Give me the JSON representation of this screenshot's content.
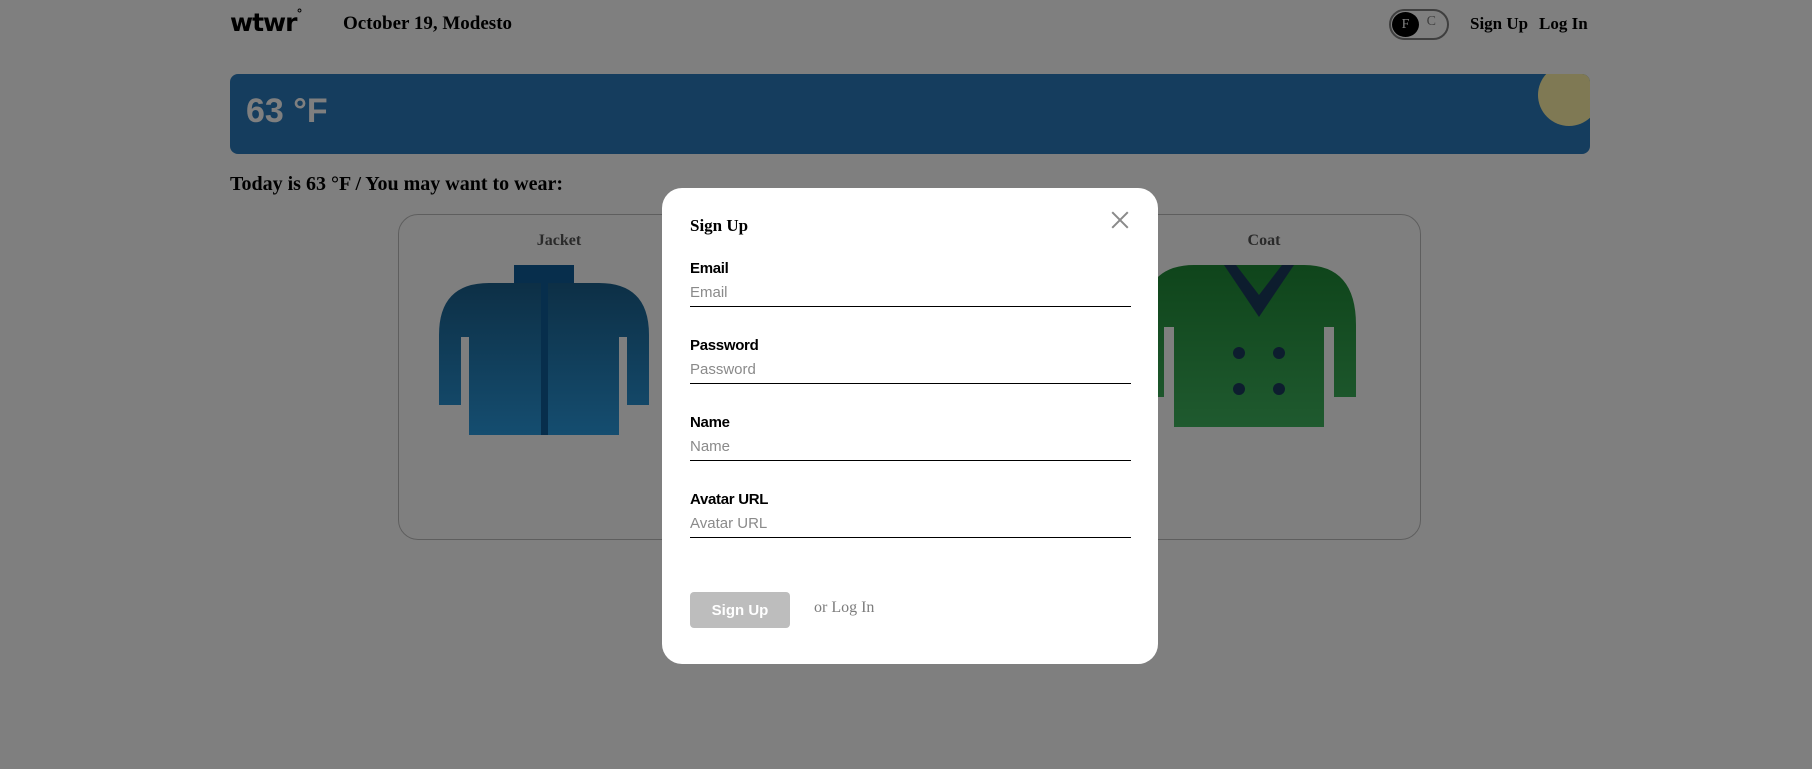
{
  "header": {
    "logo": "wtwr",
    "logo_mark": "°",
    "date_location": "October 19, Modesto",
    "unit_toggle": {
      "selected": "F",
      "other": "C"
    },
    "signup_label": "Sign Up",
    "login_label": "Log In"
  },
  "weather": {
    "temperature": "63 °F",
    "condition_icon": "sun-icon"
  },
  "main": {
    "recommendation": "Today is 63 °F / You may want to wear:",
    "items": [
      {
        "name": "Jacket",
        "icon": "jacket-icon"
      },
      {
        "name": "Coat",
        "icon": "coat-icon"
      }
    ]
  },
  "modal": {
    "title": "Sign Up",
    "fields": [
      {
        "label": "Email",
        "placeholder": "Email"
      },
      {
        "label": "Password",
        "placeholder": "Password"
      },
      {
        "label": "Name",
        "placeholder": "Name"
      },
      {
        "label": "Avatar URL",
        "placeholder": "Avatar URL"
      }
    ],
    "submit_label": "Sign Up",
    "alt_link": "or Log In"
  },
  "colors": {
    "weather_card": "#2b7bbd",
    "sun": "#fff3a8",
    "jacket": "#2a9be0",
    "coat": "#2ea84b",
    "overlay": "rgba(0,0,0,0.5)"
  }
}
